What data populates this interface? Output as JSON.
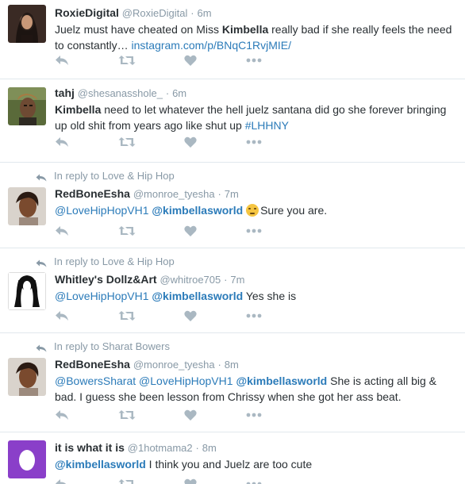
{
  "tweets": [
    {
      "name": "RoxieDigital",
      "handle": "@RoxieDigital",
      "time": "6m",
      "text_pre": "Juelz must have cheated on Miss ",
      "text_bold": "Kimbella",
      "text_post": " really bad if she really feels the need to constantly… ",
      "link": "instagram.com/p/BNqC1RvjMIE/"
    },
    {
      "name": "tahj",
      "handle": "@shesanasshole_",
      "time": "6m",
      "text_bold": "Kimbella",
      "text_post": " need to let whatever the hell juelz santana did go she forever bringing up old shit from years ago like shut up ",
      "hashtag": "#LHHNY"
    },
    {
      "reply_to": "In reply to Love & Hip Hop",
      "name": "RedBoneEsha",
      "handle": "@monroe_tyesha",
      "time": "7m",
      "mention1": "@LoveHipHopVH1",
      "mention2": "@kimbellasworld",
      "emoji": "confused-face",
      "text_post": "Sure you are."
    },
    {
      "reply_to": "In reply to Love & Hip Hop",
      "name": "Whitley's Dollz&Art",
      "handle": "@whitroe705",
      "time": "7m",
      "mention1": "@LoveHipHopVH1",
      "mention2": "@kimbellasworld",
      "text_post": " Yes she is"
    },
    {
      "reply_to": "In reply to Sharat Bowers",
      "name": "RedBoneEsha",
      "handle": "@monroe_tyesha",
      "time": "8m",
      "mention1": "@BowersSharat",
      "mention2": "@LoveHipHopVH1",
      "mention3": "@kimbellasworld",
      "text_post": " She is acting all big & bad. I guess she been lesson from Chrissy when she got her ass beat."
    },
    {
      "name": "it is what it is",
      "handle": "@1hotmama2",
      "time": "8m",
      "mention1": "@kimbellasworld",
      "text_post": " I think you and Juelz are too cute"
    }
  ],
  "separator": "·",
  "colors": {
    "text": "#292f33",
    "muted": "#8899a6",
    "link": "#2b7bb9",
    "border": "#e1e8ed",
    "action_icon": "#aab8c2"
  },
  "icons": {
    "reply": "reply-icon",
    "retweet": "retweet-icon",
    "like": "heart-icon",
    "more": "more-options-icon",
    "in_reply": "reply-arrow-icon"
  }
}
